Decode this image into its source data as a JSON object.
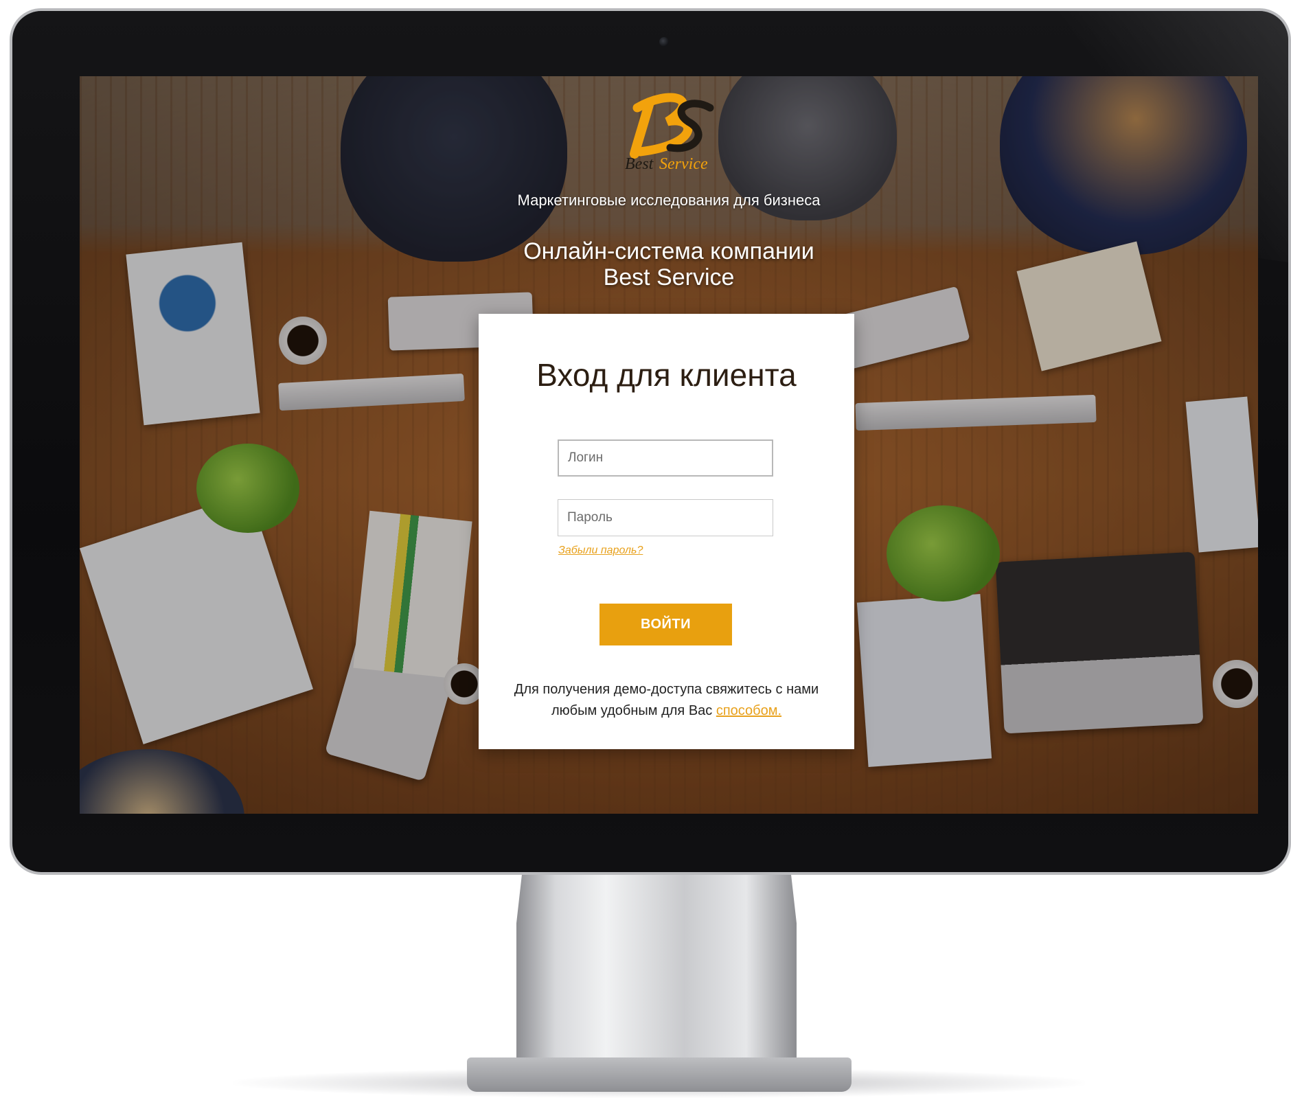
{
  "brand": {
    "logo_text": "Best Service",
    "logo_letters": "BS",
    "accent_color": "#e8a00f"
  },
  "header": {
    "tagline": "Маркетинговые исследования для бизнеса",
    "system_title_line1": "Онлайн-система компании",
    "system_title_line2": "Best Service"
  },
  "login_card": {
    "title": "Вход для клиента",
    "login_placeholder": "Логин",
    "password_placeholder": "Пароль",
    "forgot_link": "Забыли пароль?",
    "submit_label": "ВОЙТИ",
    "demo_text": "Для получения демо-доступа свяжитесь с нами любым удобным для Вас",
    "demo_link": "способом."
  }
}
